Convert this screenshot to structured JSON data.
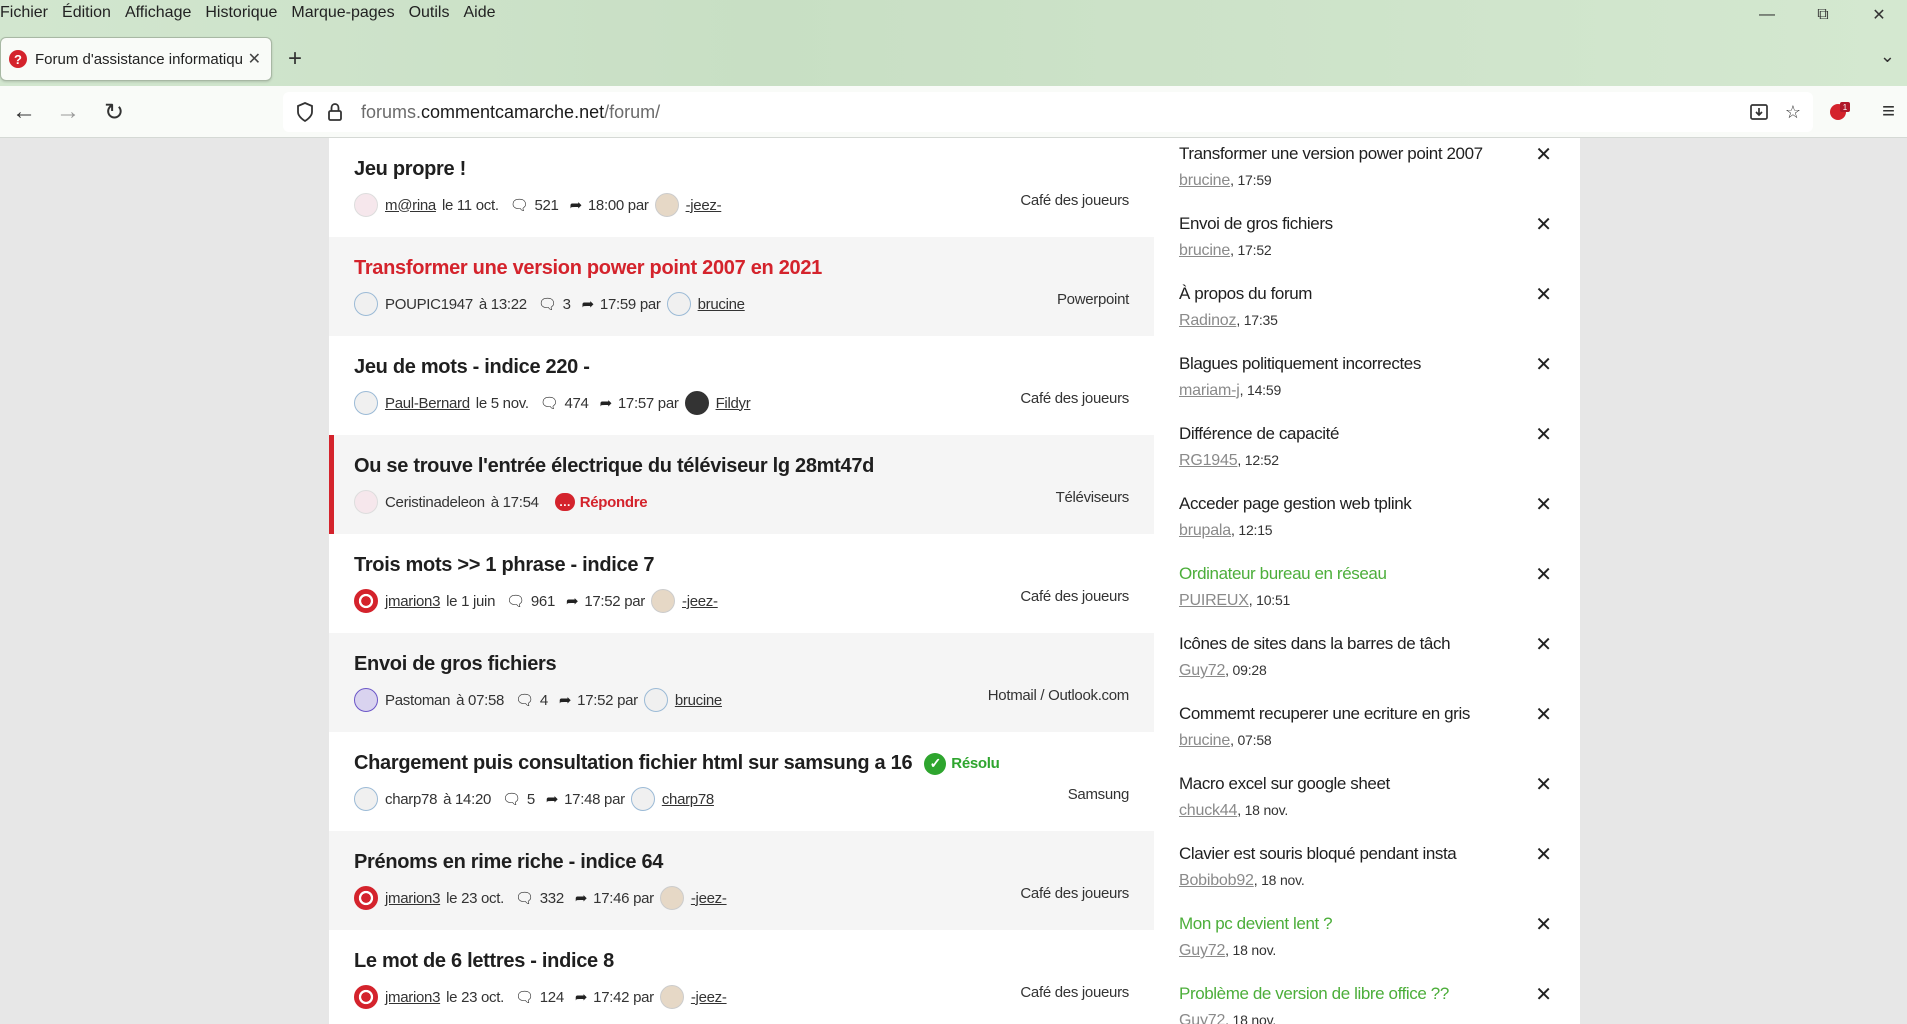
{
  "browser": {
    "menu": [
      "Fichier",
      "Édition",
      "Affichage",
      "Historique",
      "Marque-pages",
      "Outils",
      "Aide"
    ],
    "tab_title": "Forum d'assistance informatique",
    "url_domain": "forums.",
    "url_host": "commentcamarche.net",
    "url_path": "/forum/"
  },
  "topics": [
    {
      "title": "Jeu propre !",
      "author": "m@rina",
      "author_link": true,
      "date": "le 11 oct.",
      "replies": "521",
      "last_time": "18:00 par",
      "last_user": "-jeez-",
      "category": "Café des joueurs"
    },
    {
      "title": "Transformer une version power point 2007 en 2021",
      "author": "POUPIC1947",
      "author_link": false,
      "date": "à 13:22",
      "replies": "3",
      "last_time": "17:59 par",
      "last_user": "brucine",
      "category": "Powerpoint"
    },
    {
      "title": "Jeu de mots - indice 220 -",
      "author": "Paul-Bernard",
      "author_link": true,
      "date": "le 5 nov.",
      "replies": "474",
      "last_time": "17:57 par",
      "last_user": "Fildyr",
      "category": "Café des joueurs"
    },
    {
      "title": "Ou se trouve l'entrée électrique du téléviseur lg 28mt47d",
      "author": "Ceristinadeleon",
      "author_link": false,
      "date": "à 17:54",
      "reply_label": "Répondre",
      "category": "Téléviseurs"
    },
    {
      "title": "Trois mots >> 1 phrase - indice 7",
      "author": "jmarion3",
      "author_link": true,
      "date": "le 1 juin",
      "replies": "961",
      "last_time": "17:52 par",
      "last_user": "-jeez-",
      "category": "Café des joueurs"
    },
    {
      "title": "Envoi de gros fichiers",
      "author": "Pastoman",
      "author_link": false,
      "date": "à 07:58",
      "replies": "4",
      "last_time": "17:52 par",
      "last_user": "brucine",
      "category": "Hotmail / Outlook.com"
    },
    {
      "title": "Chargement puis consultation fichier html sur samsung a 16",
      "badge": "Résolu",
      "author": "charp78",
      "author_link": false,
      "date": "à 14:20",
      "replies": "5",
      "last_time": "17:48 par",
      "last_user": "charp78",
      "category": "Samsung"
    },
    {
      "title": "Prénoms en rime riche - indice 64",
      "author": "jmarion3",
      "author_link": true,
      "date": "le 23 oct.",
      "replies": "332",
      "last_time": "17:46 par",
      "last_user": "-jeez-",
      "category": "Café des joueurs"
    },
    {
      "title": "Le mot de 6 lettres - indice 8",
      "author": "jmarion3",
      "author_link": true,
      "date": "le 23 oct.",
      "replies": "124",
      "last_time": "17:42 par",
      "last_user": "-jeez-",
      "category": "Café des joueurs"
    }
  ],
  "sidebar": [
    {
      "title": "Transformer une version power point 2007",
      "user": "brucine",
      "time": ", 17:59",
      "solved": false
    },
    {
      "title": "Envoi de gros fichiers",
      "user": "brucine",
      "time": ", 17:52",
      "solved": false
    },
    {
      "title": "À propos du forum",
      "user": "Radinoz",
      "time": ", 17:35",
      "solved": false
    },
    {
      "title": "Blagues politiquement incorrectes",
      "user": "mariam-j",
      "time": ", 14:59",
      "solved": false
    },
    {
      "title": "Différence de capacité",
      "user": "RG1945",
      "time": ", 12:52",
      "solved": false
    },
    {
      "title": "Acceder page gestion web tplink",
      "user": "brupala",
      "time": ", 12:15",
      "solved": false
    },
    {
      "title": "Ordinateur bureau en réseau",
      "user": "PUIREUX",
      "time": ", 10:51",
      "solved": true
    },
    {
      "title": "Icônes de sites dans la barres de tâch",
      "user": "Guy72",
      "time": ", 09:28",
      "solved": false
    },
    {
      "title": "Commemt recuperer une ecriture en gris",
      "user": "brucine",
      "time": ", 07:58",
      "solved": false
    },
    {
      "title": "Macro excel sur google sheet",
      "user": "chuck44",
      "time": ", 18 nov.",
      "solved": false
    },
    {
      "title": "Clavier est souris bloqué pendant insta",
      "user": "Bobibob92",
      "time": ", 18 nov.",
      "solved": false
    },
    {
      "title": "Mon pc devient lent ?",
      "user": "Guy72",
      "time": ", 18 nov.",
      "solved": true
    },
    {
      "title": "Problème de version de libre office ??",
      "user": "Guy72",
      "time": ", 18 nov.",
      "solved": true
    }
  ],
  "colors": {
    "accent": "#d4232c",
    "solved": "#4cae3a",
    "chrome": "#d2e6cf"
  }
}
